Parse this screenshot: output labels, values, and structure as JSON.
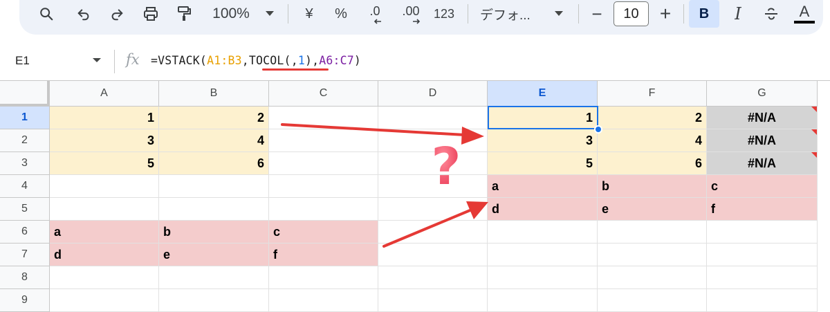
{
  "toolbar": {
    "zoom": "100%",
    "currency_label": "¥",
    "percent_label": "%",
    "decimal_decrease_label": ".0",
    "decimal_increase_label": ".00",
    "number_format_label": "123",
    "font_name": "デフォ...",
    "font_size": "10",
    "minus_label": "−",
    "plus_label": "+",
    "bold_label": "B",
    "italic_label": "I",
    "text_color_label": "A"
  },
  "formula_bar": {
    "name_box": "E1",
    "fx": "fx",
    "formula_parts": {
      "p1": "=VSTACK(",
      "p2": "A1:B3",
      "p3": ",",
      "p4": "TOCOL(,",
      "p5": "1",
      "p6": "),",
      "p7": "A6:C7",
      "p8": ")"
    }
  },
  "columns": [
    "A",
    "B",
    "C",
    "D",
    "E",
    "F",
    "G"
  ],
  "rows": [
    "1",
    "2",
    "3",
    "4",
    "5",
    "6",
    "7",
    "8",
    "9"
  ],
  "selected": {
    "column": "E",
    "row": "1"
  },
  "cells": {
    "A1": "1",
    "B1": "2",
    "A2": "3",
    "B2": "4",
    "A3": "5",
    "B3": "6",
    "A6": "a",
    "B6": "b",
    "C6": "c",
    "A7": "d",
    "B7": "e",
    "C7": "f",
    "E1": "1",
    "F1": "2",
    "G1": "#N/A",
    "E2": "3",
    "F2": "4",
    "G2": "#N/A",
    "E3": "5",
    "F3": "6",
    "G3": "#N/A",
    "E4": "a",
    "F4": "b",
    "G4": "c",
    "E5": "d",
    "F5": "e",
    "G5": "f"
  },
  "annotation": {
    "question_mark": "?"
  },
  "colors": {
    "yellow_fill": "#fdf1cf",
    "red_fill": "#f4cccc",
    "error_fill": "#d4d4d4",
    "selection": "#1a73e8",
    "arrow": "#e53935"
  }
}
